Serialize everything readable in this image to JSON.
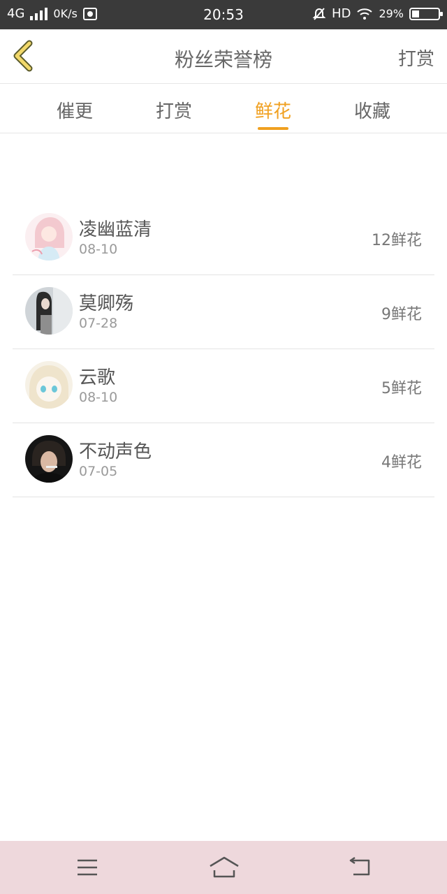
{
  "status_bar": {
    "network": "4G",
    "speed": "0K/s",
    "time": "20:53",
    "hd": "HD",
    "battery": "29%"
  },
  "header": {
    "title": "粉丝荣誉榜",
    "right_action": "打赏"
  },
  "tabs": [
    {
      "label": "催更",
      "active": false
    },
    {
      "label": "打赏",
      "active": false
    },
    {
      "label": "鲜花",
      "active": true
    },
    {
      "label": "收藏",
      "active": false
    }
  ],
  "fans": [
    {
      "name": "凌幽蓝清",
      "date": "08-10",
      "count": "12鲜花"
    },
    {
      "name": "莫卿殇",
      "date": "07-28",
      "count": "9鲜花"
    },
    {
      "name": "云歌",
      "date": "08-10",
      "count": "5鲜花"
    },
    {
      "name": "不动声色",
      "date": "07-05",
      "count": "4鲜花"
    }
  ],
  "colors": {
    "accent": "#f0a020",
    "status_bar": "#3a3a3a",
    "nav_bar": "#eed8dc",
    "divider": "#e3e3e3"
  },
  "icons": {
    "back": "chevron-left-icon",
    "nav_menu": "menu-icon",
    "nav_home": "home-icon",
    "nav_back": "return-icon"
  }
}
